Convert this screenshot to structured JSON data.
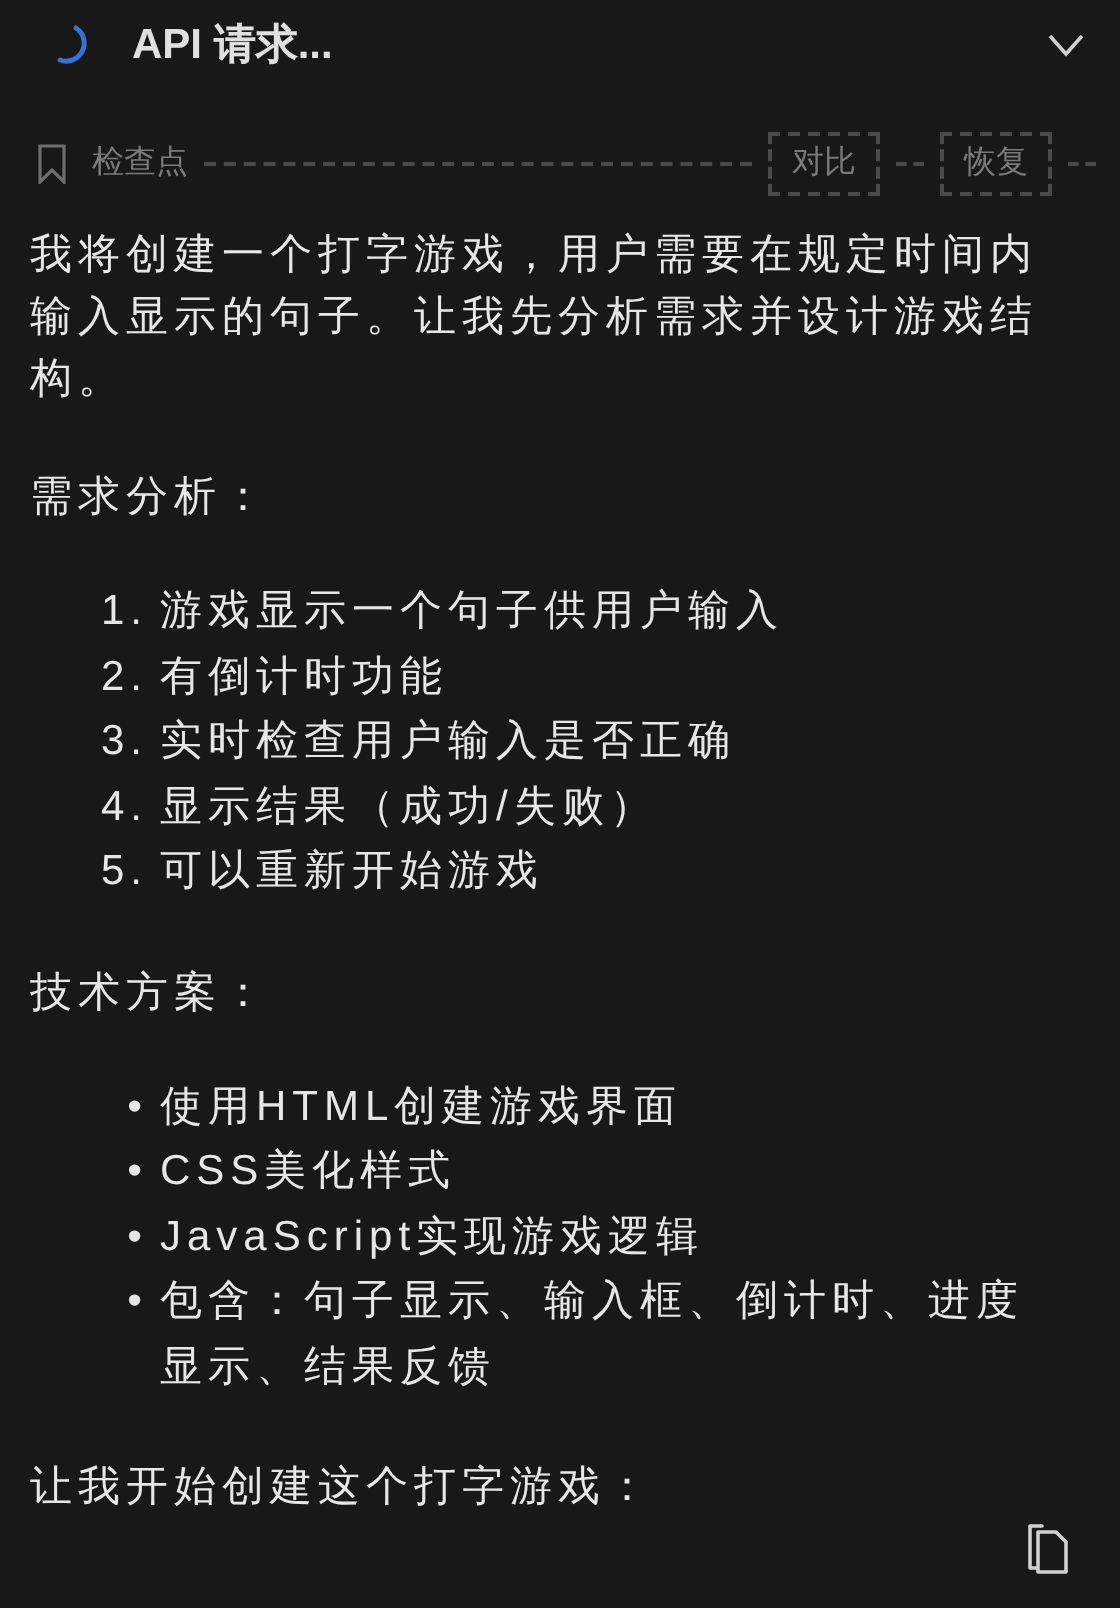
{
  "header": {
    "title": "API 请求...",
    "expanded": false
  },
  "checkpoint": {
    "label": "检查点",
    "buttons": [
      "对比",
      "恢复"
    ]
  },
  "blocks": [
    {
      "kind": "paragraph",
      "text": "我将创建一个打字游戏，用户需要在规定时间内输入显示的句子。让我先分析需求并设计游戏结构。"
    },
    {
      "kind": "paragraph",
      "text": "需求分析："
    },
    {
      "kind": "list",
      "items": [
        {
          "marker": "1.",
          "text": "游戏显示一个句子供用户输入"
        },
        {
          "marker": "2.",
          "text": "有倒计时功能"
        },
        {
          "marker": "3.",
          "text": "实时检查用户输入是否正确"
        },
        {
          "marker": "4.",
          "text": "显示结果（成功/失败）"
        },
        {
          "marker": "5.",
          "text": "可以重新开始游戏"
        }
      ]
    },
    {
      "kind": "paragraph",
      "text": "技术方案："
    },
    {
      "kind": "list",
      "items": [
        {
          "marker": "•",
          "text": "使用HTML创建游戏界面"
        },
        {
          "marker": "•",
          "text": "CSS美化样式"
        },
        {
          "marker": "•",
          "text": "JavaScript实现游戏逻辑"
        },
        {
          "marker": "•",
          "text": "包含：句子显示、输入框、倒计时、进度显示、结果反馈"
        }
      ]
    },
    {
      "kind": "paragraph",
      "text": "让我开始创建这个打字游戏："
    }
  ]
}
